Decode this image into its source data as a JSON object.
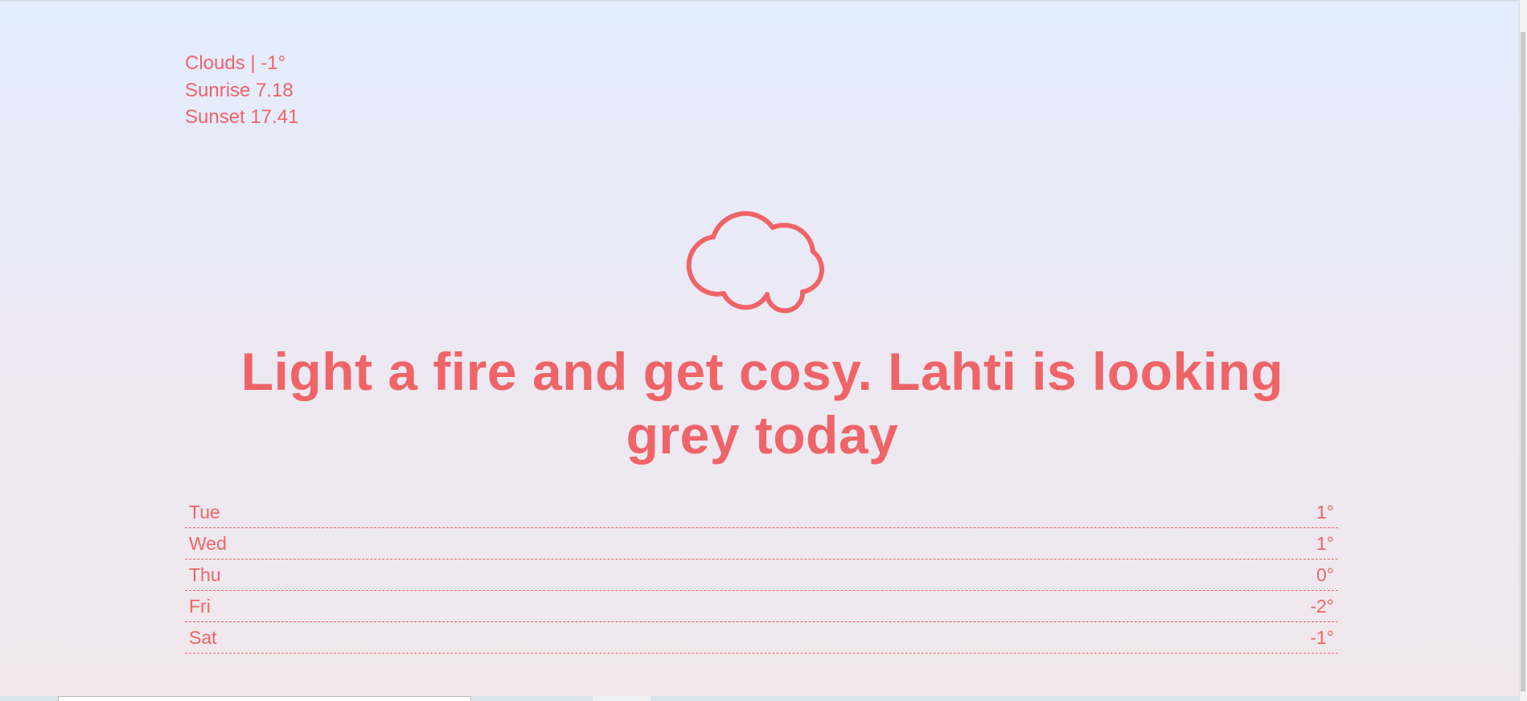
{
  "summary": {
    "condition_line": "Clouds | -1°",
    "sunrise": "Sunrise 7.18",
    "sunset": "Sunset 17.41"
  },
  "icon": {
    "name": "cloud-icon",
    "color": "#ef6467"
  },
  "headline": "Light a fire and get cosy. Lahti is looking grey today",
  "forecast": [
    {
      "day": "Tue",
      "temp": "1°"
    },
    {
      "day": "Wed",
      "temp": "1°"
    },
    {
      "day": "Thu",
      "temp": "0°"
    },
    {
      "day": "Fri",
      "temp": "-2°"
    },
    {
      "day": "Sat",
      "temp": "-1°"
    }
  ],
  "colors": {
    "accent": "#ef6467",
    "background_top": "#e3edff",
    "background_bottom": "#f1e7ea"
  }
}
